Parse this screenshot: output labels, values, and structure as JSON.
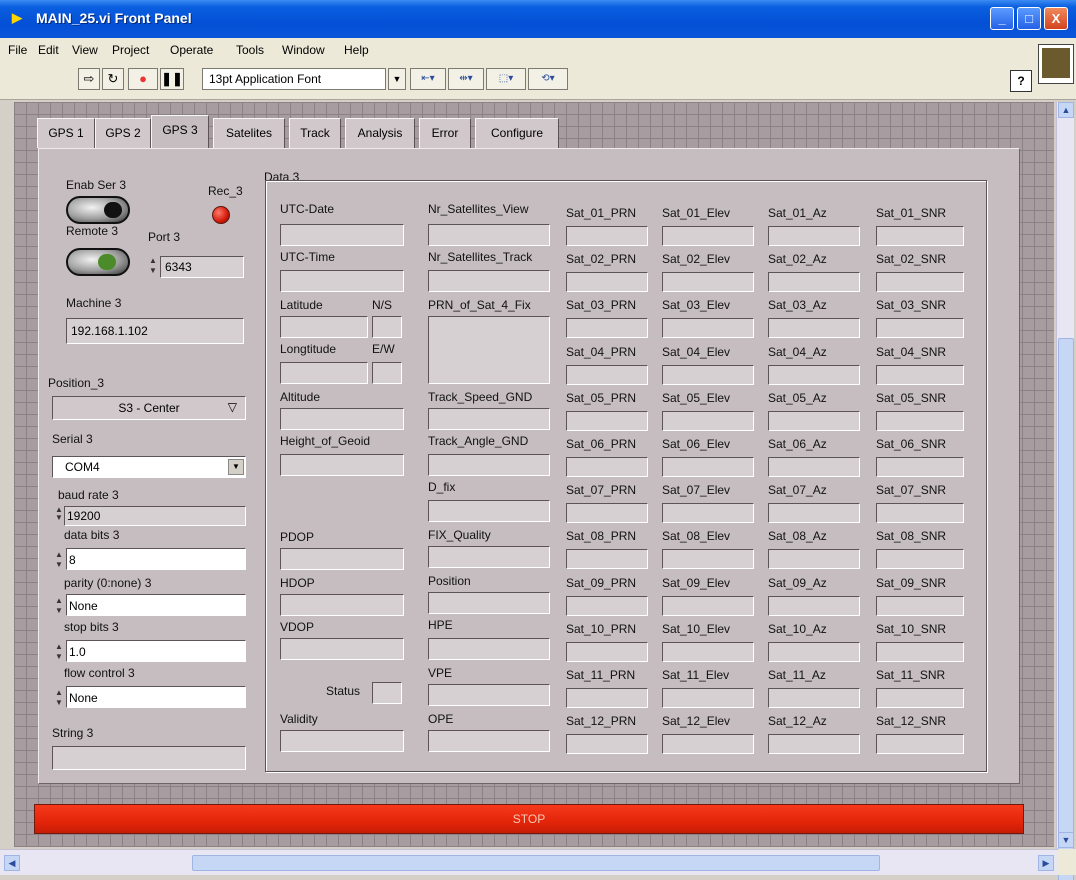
{
  "window": {
    "title": "MAIN_25.vi Front Panel",
    "controls": {
      "minimize": "_",
      "maximize": "□",
      "close": "X"
    }
  },
  "menu": {
    "items": [
      "File",
      "Edit",
      "View",
      "Project",
      "Operate",
      "Tools",
      "Window",
      "Help"
    ]
  },
  "toolbar": {
    "font": "13pt Application Font",
    "help": "?"
  },
  "tabs": [
    "GPS 1",
    "GPS 2",
    "GPS 3",
    "Satelites",
    "Track",
    "Analysis",
    "Error",
    "Configure"
  ],
  "active_tab": "GPS 3",
  "left": {
    "enab_ser_label": "Enab Ser 3",
    "rec_label": "Rec_3",
    "remote_label": "Remote 3",
    "port_label": "Port 3",
    "port_value": "6343",
    "machine_label": "Machine 3",
    "machine_value": "192.168.1.102",
    "position_label": "Position_3",
    "position_value": "S3 - Center",
    "serial_label": "Serial 3",
    "serial_value": "COM4",
    "baud_label": "baud rate 3",
    "baud_value": "19200",
    "databits_label": "data bits 3",
    "databits_value": "8",
    "parity_label": "parity (0:none) 3",
    "parity_value": "None",
    "stopbits_label": "stop bits 3",
    "stopbits_value": "1.0",
    "flow_label": "flow control 3",
    "flow_value": "None",
    "string_label": "String 3"
  },
  "data3": {
    "title": "Data 3",
    "col1": {
      "utc_date": "UTC-Date",
      "utc_time": "UTC-Time",
      "latitude": "Latitude",
      "ns": "N/S",
      "longitude": "Longtitude",
      "ew": "E/W",
      "altitude": "Altitude",
      "height_geoid": "Height_of_Geoid",
      "pdop": "PDOP",
      "hdop": "HDOP",
      "vdop": "VDOP",
      "status": "Status",
      "validity": "Validity"
    },
    "col2": {
      "sat_view": "Nr_Satellites_View",
      "sat_track": "Nr_Satellites_Track",
      "prn_fix": "PRN_of_Sat_4_Fix",
      "speed": "Track_Speed_GND",
      "angle": "Track_Angle_GND",
      "dfix": "D_fix",
      "fixq": "FIX_Quality",
      "position": "Position",
      "hpe": "HPE",
      "vpe": "VPE",
      "ope": "OPE"
    },
    "sats": [
      {
        "prn": "Sat_01_PRN",
        "elev": "Sat_01_Elev",
        "az": "Sat_01_Az",
        "snr": "Sat_01_SNR"
      },
      {
        "prn": "Sat_02_PRN",
        "elev": "Sat_02_Elev",
        "az": "Sat_02_Az",
        "snr": "Sat_02_SNR"
      },
      {
        "prn": "Sat_03_PRN",
        "elev": "Sat_03_Elev",
        "az": "Sat_03_Az",
        "snr": "Sat_03_SNR"
      },
      {
        "prn": "Sat_04_PRN",
        "elev": "Sat_04_Elev",
        "az": "Sat_04_Az",
        "snr": "Sat_04_SNR"
      },
      {
        "prn": "Sat_05_PRN",
        "elev": "Sat_05_Elev",
        "az": "Sat_05_Az",
        "snr": "Sat_05_SNR"
      },
      {
        "prn": "Sat_06_PRN",
        "elev": "Sat_06_Elev",
        "az": "Sat_06_Az",
        "snr": "Sat_06_SNR"
      },
      {
        "prn": "Sat_07_PRN",
        "elev": "Sat_07_Elev",
        "az": "Sat_07_Az",
        "snr": "Sat_07_SNR"
      },
      {
        "prn": "Sat_08_PRN",
        "elev": "Sat_08_Elev",
        "az": "Sat_08_Az",
        "snr": "Sat_08_SNR"
      },
      {
        "prn": "Sat_09_PRN",
        "elev": "Sat_09_Elev",
        "az": "Sat_09_Az",
        "snr": "Sat_09_SNR"
      },
      {
        "prn": "Sat_10_PRN",
        "elev": "Sat_10_Elev",
        "az": "Sat_10_Az",
        "snr": "Sat_10_SNR"
      },
      {
        "prn": "Sat_11_PRN",
        "elev": "Sat_11_Elev",
        "az": "Sat_11_Az",
        "snr": "Sat_11_SNR"
      },
      {
        "prn": "Sat_12_PRN",
        "elev": "Sat_12_Elev",
        "az": "Sat_12_Az",
        "snr": "Sat_12_SNR"
      }
    ]
  },
  "stop_button": "STOP",
  "colors": {
    "panel_bg": "#c5bdc0",
    "stop_red": "#e3250a",
    "titlebar_blue": "#0450d6",
    "led_red": "#d31a0a"
  }
}
